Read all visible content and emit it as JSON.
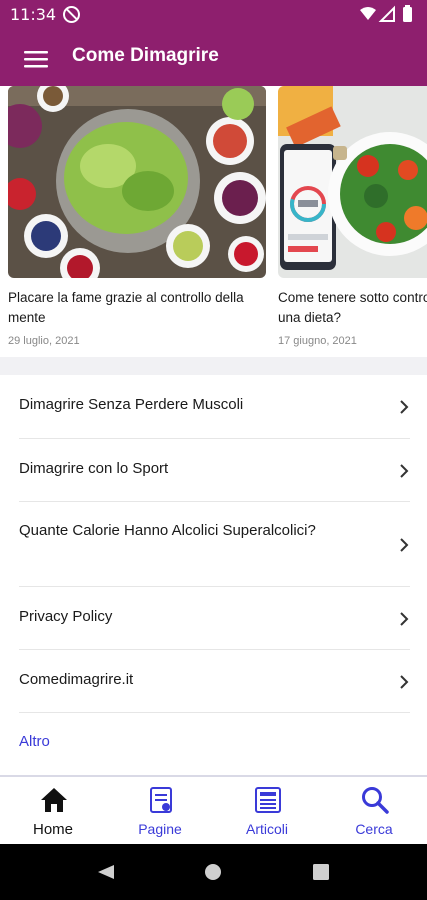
{
  "status_bar": {
    "time": "11:34"
  },
  "app_bar": {
    "title": "Come Dimagrire"
  },
  "carousel": [
    {
      "title": "Placare la fame grazie al controllo della mente",
      "date": "29 luglio, 2021"
    },
    {
      "title": "Come tenere sotto controllo le calorie in una dieta?",
      "date": "17 giugno, 2021"
    }
  ],
  "menu_items": [
    {
      "label": "Dimagrire Senza Perdere Muscoli"
    },
    {
      "label": "Dimagrire con lo Sport"
    },
    {
      "label": "Quante Calorie Hanno Alcolici Superalcolici?"
    },
    {
      "label": "Privacy Policy"
    },
    {
      "label": "Comedimagrire.it"
    }
  ],
  "more_link": "Altro",
  "bottom_nav": {
    "home": "Home",
    "pages": "Pagine",
    "articles": "Articoli",
    "search": "Cerca"
  },
  "colors": {
    "primary": "#8e1f6e",
    "accent": "#3a3ad8"
  }
}
